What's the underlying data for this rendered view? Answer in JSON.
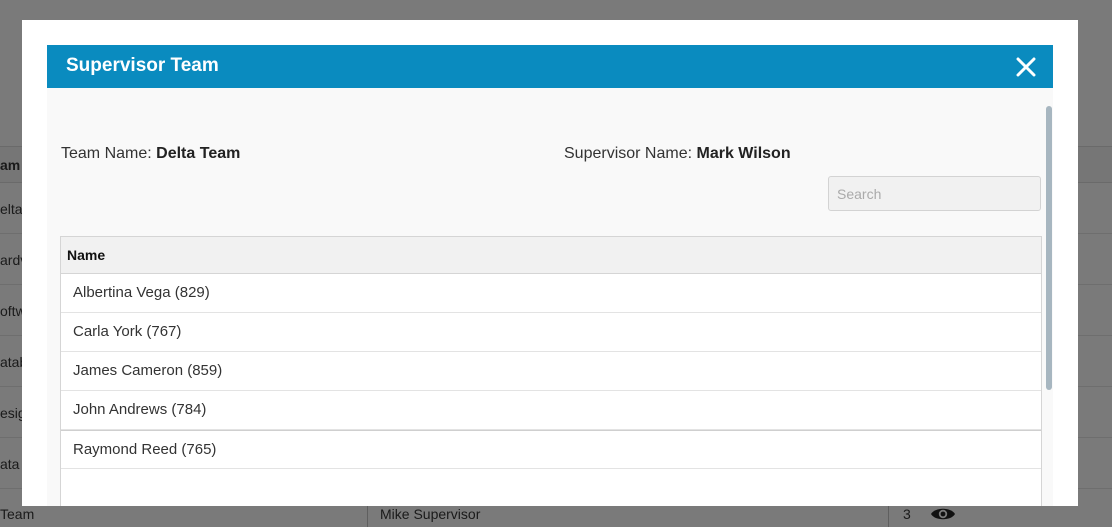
{
  "background": {
    "header_label": "am I",
    "rows": [
      "elta",
      "ardv",
      "oftw",
      "atab",
      "esig",
      "ata T"
    ],
    "bottom_row": {
      "team": "Team",
      "supervisor": "Mike Supervisor",
      "count": "3"
    }
  },
  "modal": {
    "title": "Supervisor Team",
    "team_name_label": "Team Name:",
    "team_name_value": "Delta Team",
    "supervisor_label": "Supervisor Name:",
    "supervisor_value": "Mark Wilson",
    "search_placeholder": "Search",
    "table": {
      "column_header": "Name",
      "rows": [
        "Albertina Vega (829)",
        "Carla York (767)",
        "James Cameron (859)",
        "John Andrews (784)",
        "Raymond Reed (765)",
        ""
      ]
    }
  },
  "colors": {
    "header": "#0a8bbf",
    "overlay": "#7a7a7a"
  },
  "icons": {
    "close": "close-icon",
    "eye": "eye-icon"
  }
}
